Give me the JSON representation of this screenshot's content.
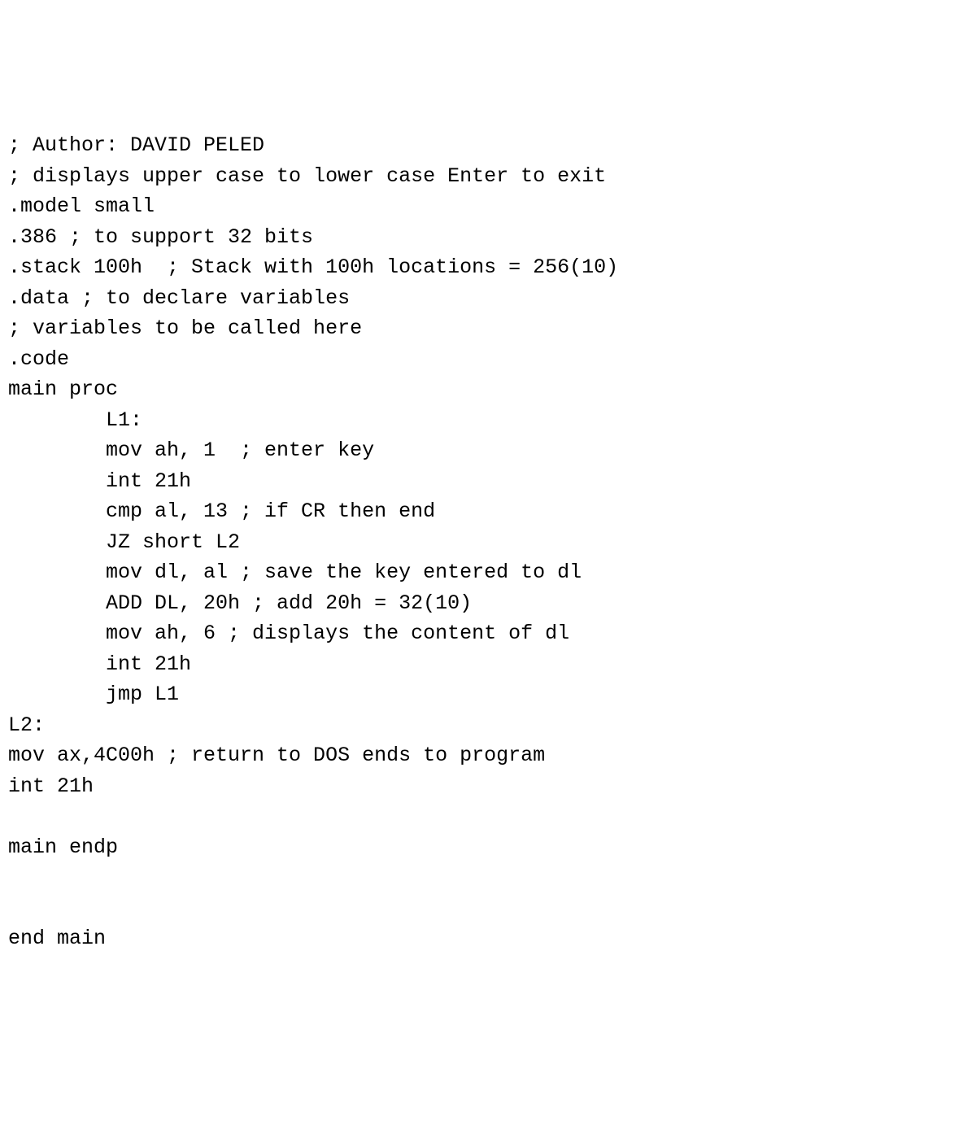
{
  "code": {
    "lines": [
      "; Author: DAVID PELED",
      "; displays upper case to lower case Enter to exit",
      ".model small",
      ".386 ; to support 32 bits",
      ".stack 100h  ; Stack with 100h locations = 256(10)",
      ".data ; to declare variables",
      "; variables to be called here",
      ".code",
      "main proc",
      "        L1:",
      "        mov ah, 1  ; enter key",
      "        int 21h",
      "        cmp al, 13 ; if CR then end",
      "        JZ short L2",
      "        mov dl, al ; save the key entered to dl",
      "        ADD DL, 20h ; add 20h = 32(10)",
      "        mov ah, 6 ; displays the content of dl",
      "        int 21h",
      "        jmp L1",
      "L2:",
      "mov ax,4C00h ; return to DOS ends to program",
      "int 21h",
      "",
      "main endp",
      "",
      "",
      "end main"
    ]
  }
}
